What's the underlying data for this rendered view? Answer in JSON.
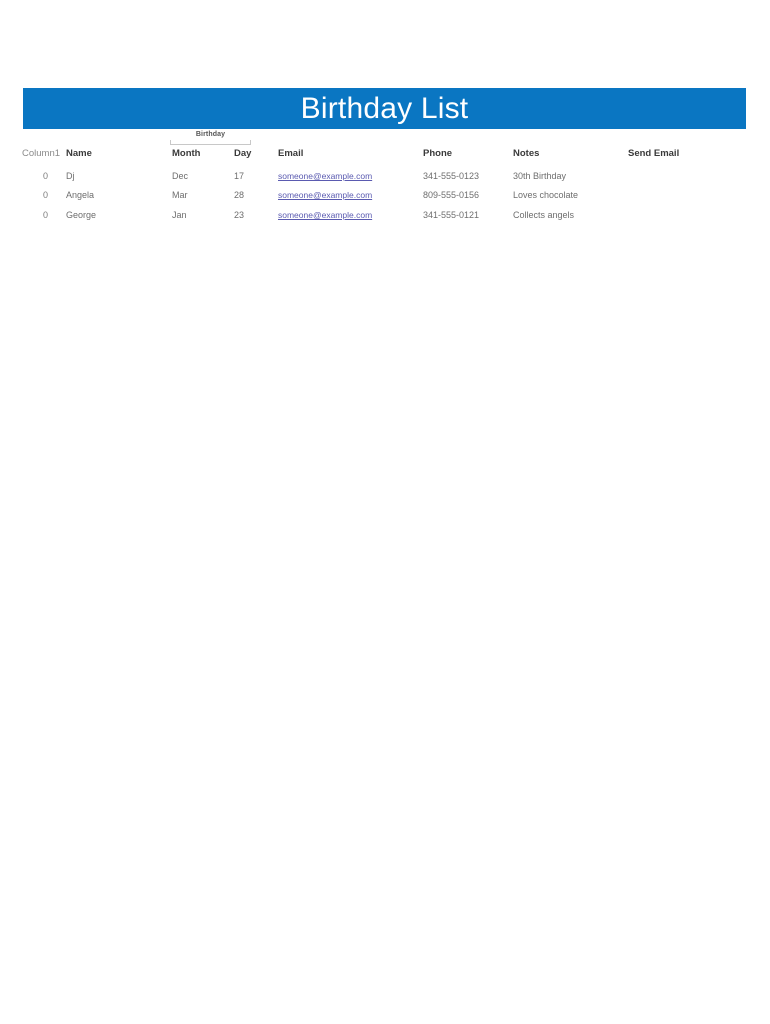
{
  "document": {
    "title": "Birthday List",
    "banner_color": "#0A76C2",
    "title_color": "#FFFFFF"
  },
  "group_headers": [
    {
      "label": "Birthday",
      "spans": [
        "Month",
        "Day"
      ]
    }
  ],
  "table": {
    "columns": [
      {
        "key": "column1",
        "label": "Column1"
      },
      {
        "key": "name",
        "label": "Name"
      },
      {
        "key": "month",
        "label": "Month"
      },
      {
        "key": "day",
        "label": "Day"
      },
      {
        "key": "email",
        "label": "Email"
      },
      {
        "key": "phone",
        "label": "Phone"
      },
      {
        "key": "notes",
        "label": "Notes"
      },
      {
        "key": "send_email",
        "label": "Send Email"
      }
    ],
    "rows": [
      {
        "column1": "0",
        "name": "Dj",
        "month": "Dec",
        "day": "17",
        "email": "someone@example.com",
        "phone": "341-555-0123",
        "notes": "30th Birthday",
        "send_email": ""
      },
      {
        "column1": "0",
        "name": "Angela",
        "month": "Mar",
        "day": "28",
        "email": "someone@example.com",
        "phone": "809-555-0156",
        "notes": "Loves chocolate",
        "send_email": ""
      },
      {
        "column1": "0",
        "name": "George",
        "month": "Jan",
        "day": "23",
        "email": "someone@example.com",
        "phone": "341-555-0121",
        "notes": "Collects angels",
        "send_email": ""
      }
    ]
  },
  "colors": {
    "link": "#5A5AB0",
    "header_text": "#3A3A3A",
    "body_text": "#6E6E6E",
    "muted_text": "#8B8B8B"
  }
}
